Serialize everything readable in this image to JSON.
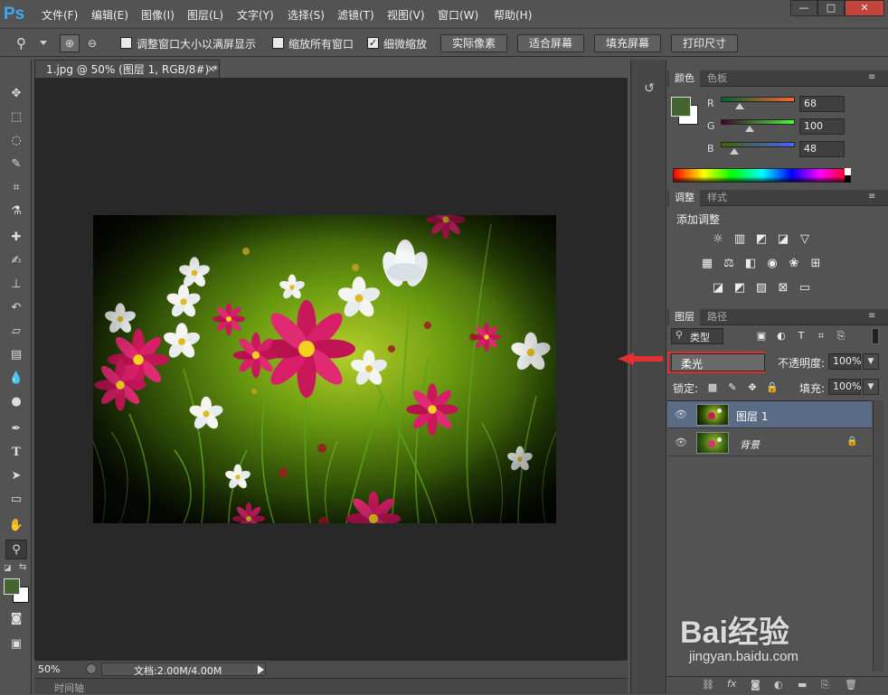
{
  "app": {
    "logo": "Ps"
  },
  "menu": [
    "文件(F)",
    "编辑(E)",
    "图像(I)",
    "图层(L)",
    "文字(Y)",
    "选择(S)",
    "滤镜(T)",
    "视图(V)",
    "窗口(W)",
    "帮助(H)"
  ],
  "window_controls": {
    "minimize": "—",
    "maximize": "□",
    "close": "✕"
  },
  "options": {
    "resize_windows_label": "调整窗口大小以满屏显示",
    "resize_windows_checked": false,
    "zoom_all_label": "缩放所有窗口",
    "zoom_all_checked": false,
    "scrubby_zoom_label": "细微缩放",
    "scrubby_zoom_checked": true,
    "actual_pixels": "实际像素",
    "fit_screen": "适合屏幕",
    "fill_screen": "填充屏幕",
    "print_size": "打印尺寸"
  },
  "document": {
    "tab_title": "1.jpg @ 50% (图层 1, RGB/8#) *",
    "zoom": "50%",
    "doc_info": "文档:2.00M/4.00M",
    "timeline": "时间轴"
  },
  "color_panel": {
    "tabs": [
      "颜色",
      "色板"
    ],
    "r_label": "R",
    "r_value": "68",
    "g_label": "G",
    "g_value": "100",
    "b_label": "B",
    "b_value": "48",
    "foreground": "#446430",
    "background": "#ffffff"
  },
  "adjustments_panel": {
    "tabs": [
      "调整",
      "样式"
    ],
    "heading": "添加调整"
  },
  "layers_panel": {
    "tabs": [
      "图层",
      "路径"
    ],
    "filter_kind": "类型",
    "blend_mode": "柔光",
    "opacity_label": "不透明度:",
    "opacity_value": "100%",
    "lock_label": "锁定:",
    "fill_label": "填充:",
    "fill_value": "100%",
    "layers": [
      {
        "name": "图层 1",
        "selected": true,
        "locked": false
      },
      {
        "name": "背景",
        "selected": false,
        "locked": true
      }
    ]
  },
  "watermark": {
    "brand": "Bai经验",
    "url": "jingyan.baidu.com"
  },
  "colors": {
    "accent": "#3fa9f5",
    "highlight_box": "#e03030"
  }
}
